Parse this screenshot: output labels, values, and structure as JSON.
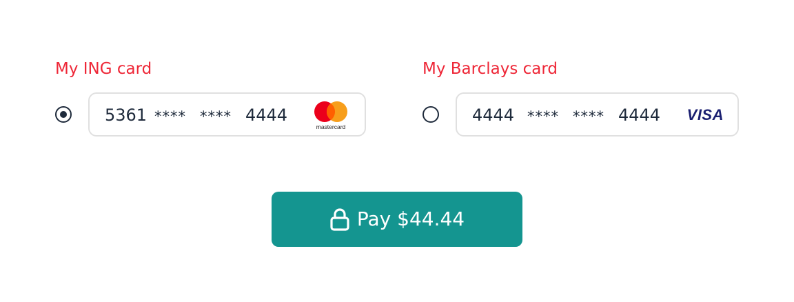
{
  "cards": [
    {
      "title": "My ING card",
      "selected": true,
      "number": {
        "first": "5361",
        "mask1": "****",
        "mask2": "****",
        "last": "4444"
      },
      "brand": "mastercard",
      "brand_label": "mastercard"
    },
    {
      "title": "My Barclays card",
      "selected": false,
      "number": {
        "first": "4444",
        "mask1": "****",
        "mask2": "****",
        "last": "4444"
      },
      "brand": "visa",
      "brand_label": "VISA"
    }
  ],
  "pay_button": {
    "label": "Pay $44.44",
    "icon": "lock-icon"
  },
  "colors": {
    "title": "#ee2737",
    "text": "#1e2a3b",
    "button": "#149590",
    "border": "#e0e0e0",
    "mastercard_red": "#eb001b",
    "mastercard_orange": "#f79e1b",
    "visa_blue": "#1a1f71"
  }
}
